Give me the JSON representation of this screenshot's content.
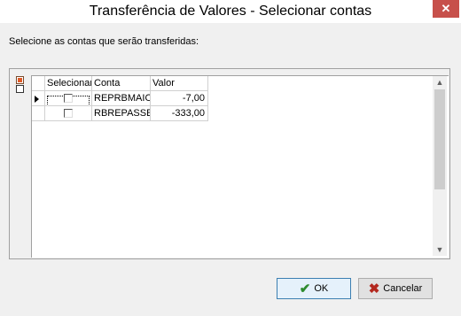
{
  "window": {
    "title": "Transferência de Valores - Selecionar contas",
    "close_icon": "close-icon"
  },
  "prompt": "Selecione as contas que serão transferidas:",
  "toolbar": {
    "check_all_icon": "checked-box-icon",
    "uncheck_all_icon": "unchecked-box-icon"
  },
  "grid": {
    "headers": [
      "Selecionar",
      "Conta",
      "Valor"
    ],
    "rows": [
      {
        "selected": false,
        "conta": "REPRBMAIOR",
        "valor": "-7,00",
        "current": true
      },
      {
        "selected": false,
        "conta": "RBREPASSE",
        "valor": "-333,00",
        "current": false
      }
    ]
  },
  "buttons": {
    "ok_label": "OK",
    "cancel_label": "Cancelar"
  },
  "colors": {
    "close_button": "#c7504b",
    "ok_icon": "#2e8b2e",
    "cancel_icon": "#b3281e"
  }
}
